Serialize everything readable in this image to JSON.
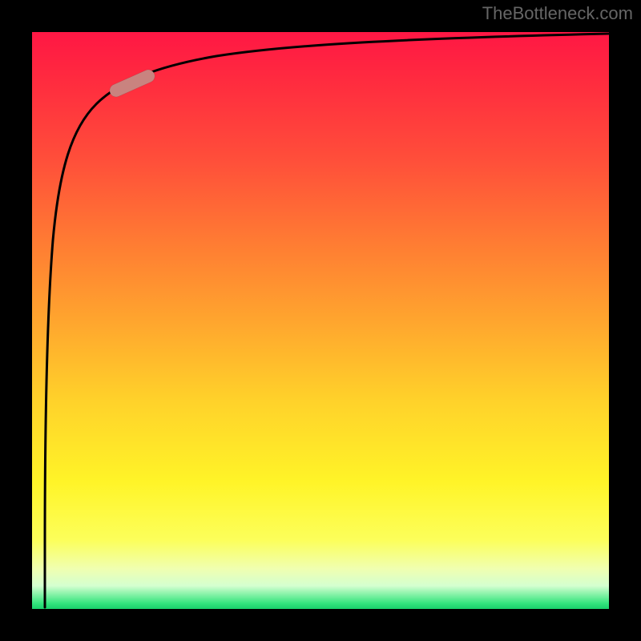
{
  "attribution": "TheBottleneck.com",
  "colors": {
    "frame_bg": "#000000",
    "gradient_top": "#ff1744",
    "gradient_mid": "#ffd22a",
    "gradient_bottom": "#19d06a",
    "curve": "#000000",
    "marker": "#c9837f"
  },
  "chart_data": {
    "type": "line",
    "title": "",
    "xlabel": "",
    "ylabel": "",
    "xlim": [
      0,
      100
    ],
    "ylim": [
      0,
      100
    ],
    "x": [
      0,
      0.5,
      1,
      1.5,
      2,
      3,
      4,
      6,
      8,
      12,
      18,
      25,
      35,
      50,
      70,
      100
    ],
    "values": [
      0,
      40,
      60,
      72,
      78,
      83,
      86,
      89,
      91,
      93,
      94.5,
      95.5,
      96.5,
      97.5,
      98.3,
      99
    ],
    "marker": {
      "x_pct": 16,
      "y_pct": 91,
      "length_pct": 8,
      "angle_deg": -20
    }
  }
}
